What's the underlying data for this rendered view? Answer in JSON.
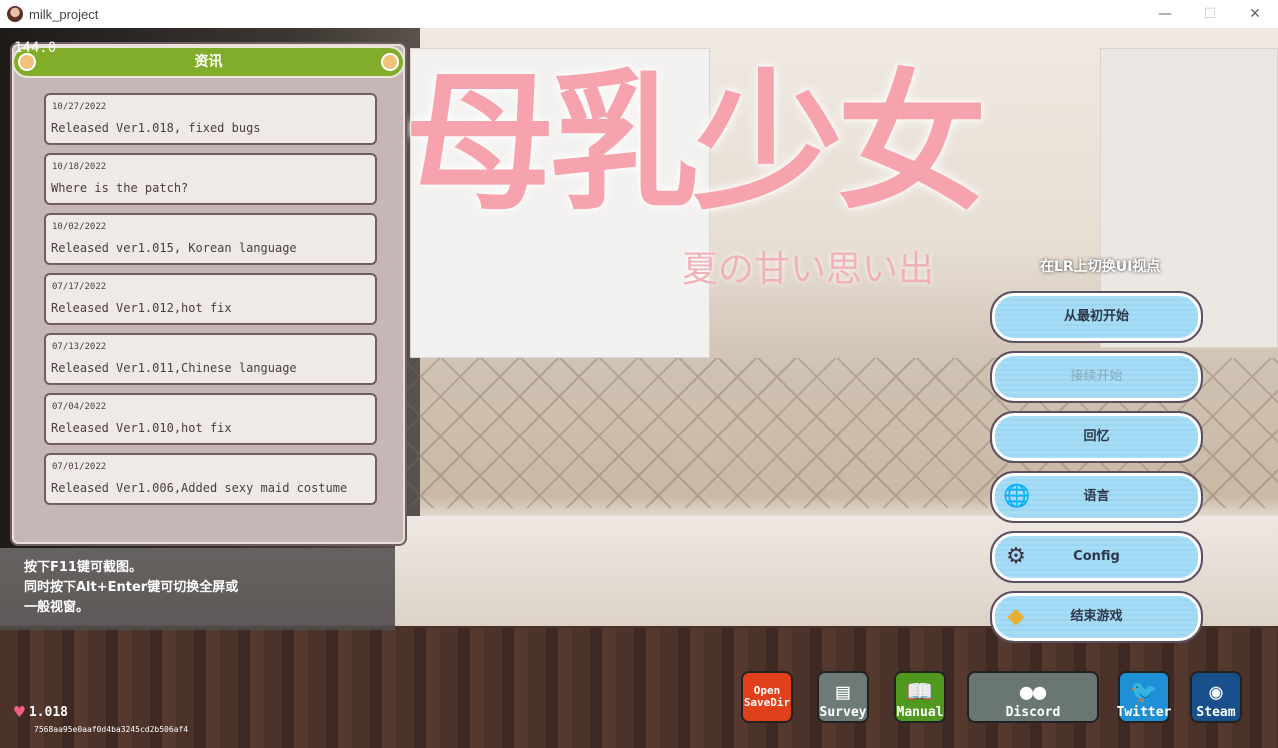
{
  "window": {
    "title": "milk_project",
    "minimize": "—",
    "maximize": "☐",
    "close": "✕"
  },
  "game": {
    "fps": "144.0",
    "logo": "母乳少女",
    "logo_subtitle": "夏の甘い思い出",
    "news": {
      "title": "资讯",
      "items": [
        {
          "date": "10/27/2022",
          "text": "Released Ver1.018, fixed bugs"
        },
        {
          "date": "10/18/2022",
          "text": "Where is the patch?"
        },
        {
          "date": "10/02/2022",
          "text": "Released ver1.015, Korean language"
        },
        {
          "date": "07/17/2022",
          "text": "Released Ver1.012,hot fix"
        },
        {
          "date": "07/13/2022",
          "text": "Released Ver1.011,Chinese language"
        },
        {
          "date": "07/04/2022",
          "text": "Released Ver1.010,hot fix"
        },
        {
          "date": "07/01/2022",
          "text": "Released Ver1.006,Added sexy maid costume"
        }
      ]
    },
    "tips": [
      "按下F11键可截图。",
      "同时按下Alt+Enter键可切换全屏或",
      "一般视窗。"
    ],
    "version": "1.018",
    "build_hash": "7568aa95e0aaf0d4ba3245cd2b506af4",
    "hint": "在LR上切换UI视点",
    "menu": [
      {
        "label": "从最初开始",
        "enabled": true
      },
      {
        "label": "接续开始",
        "enabled": false
      },
      {
        "label": "回忆",
        "enabled": true
      },
      {
        "label": "语言",
        "icon": "globe-icon",
        "enabled": true
      },
      {
        "label": "Config",
        "icon": "gear-icon",
        "enabled": true
      },
      {
        "label": "结束游戏",
        "icon": "crystal-icon",
        "enabled": true
      }
    ],
    "social": [
      {
        "label": "Open SaveDir",
        "color": "#e0401a"
      },
      {
        "label": "Survey",
        "icon": "document-icon",
        "color": "#6e7a78"
      },
      {
        "label": "Manual",
        "icon": "book-icon",
        "color": "#4f9a1e"
      },
      {
        "label": "Discord",
        "icon": "discord-icon",
        "color": "#6a7674"
      },
      {
        "label": "Twitter",
        "icon": "twitter-icon",
        "color": "#1f8fd6"
      },
      {
        "label": "Steam",
        "icon": "steam-icon",
        "color": "#17508a"
      }
    ]
  }
}
